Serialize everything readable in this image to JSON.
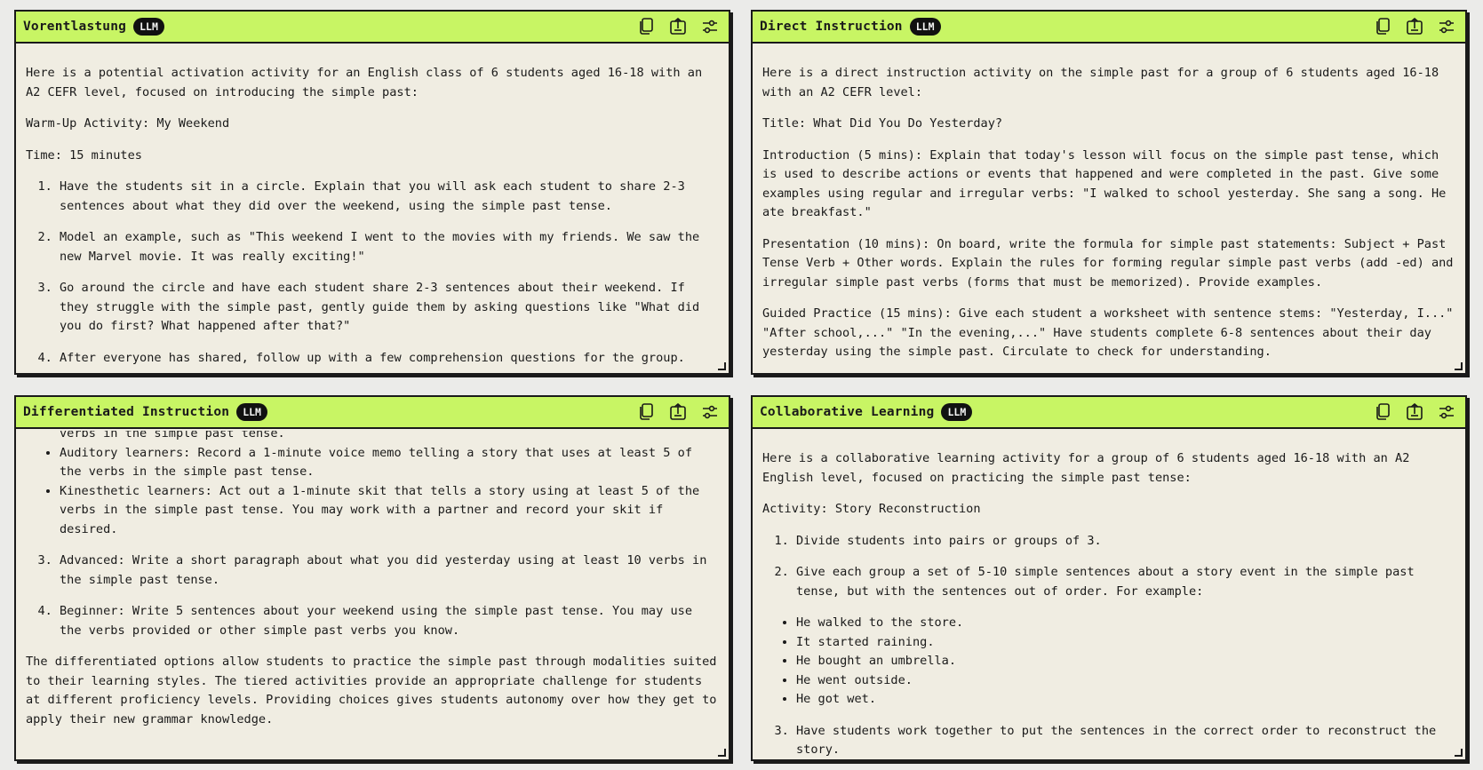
{
  "panels": [
    {
      "title": "Vorentlastung",
      "badge": "LLM",
      "intro": "Here is a potential activation activity for an English class of 6 students aged 16-18 with an A2 CEFR level, focused on introducing the simple past:",
      "activity": "Warm-Up Activity: My Weekend",
      "time": "Time: 15 minutes",
      "steps": [
        "Have the students sit in a circle. Explain that you will ask each student to share 2-3 sentences about what they did over the weekend, using the simple past tense.",
        "Model an example, such as \"This weekend I went to the movies with my friends. We saw the new Marvel movie. It was really exciting!\"",
        "Go around the circle and have each student share 2-3 sentences about their weekend. If they struggle with the simple past, gently guide them by asking questions like \"What did you do first? What happened after that?\"",
        "After everyone has shared, follow up with a few comprehension questions for the group."
      ]
    },
    {
      "title": "Direct Instruction",
      "badge": "LLM",
      "intro": "Here is a direct instruction activity on the simple past for a group of 6 students aged 16-18 with an A2 CEFR level:",
      "activity": "Title: What Did You Do Yesterday?",
      "paragraphs": [
        "Introduction (5 mins): Explain that today's lesson will focus on the simple past tense, which is used to describe actions or events that happened and were completed in the past. Give some examples using regular and irregular verbs: \"I walked to school yesterday. She sang a song. He ate breakfast.\"",
        "Presentation (10 mins): On board, write the formula for simple past statements: Subject + Past Tense Verb + Other words. Explain the rules for forming regular simple past verbs (add -ed) and irregular simple past verbs (forms that must be memorized). Provide examples.",
        "Guided Practice (15 mins): Give each student a worksheet with sentence stems: \"Yesterday, I...\" \"After school,...\" \"In the evening,...\" Have students complete 6-8 sentences about their day yesterday using the simple past. Circulate to check for understanding."
      ]
    },
    {
      "title": "Differentiated Instruction",
      "badge": "LLM",
      "bullet_partial": "verbs in the simple past tense.",
      "bullets": [
        "Auditory learners: Record a 1-minute voice memo telling a story that uses at least 5 of the verbs in the simple past tense.",
        "Kinesthetic learners: Act out a 1-minute skit that tells a story using at least 5 of the verbs in the simple past tense. You may work with a partner and record your skit if desired."
      ],
      "steps": [
        "Advanced: Write a short paragraph about what you did yesterday using at least 10 verbs in the simple past tense.",
        "Beginner: Write 5 sentences about your weekend using the simple past tense. You may use the verbs provided or other simple past verbs you know."
      ],
      "conclusion": "The differentiated options allow students to practice the simple past through modalities suited to their learning styles. The tiered activities provide an appropriate challenge for students at different proficiency levels. Providing choices gives students autonomy over how they get to apply their new grammar knowledge."
    },
    {
      "title": "Collaborative Learning",
      "badge": "LLM",
      "intro": "Here is a collaborative learning activity for a group of 6 students aged 16-18 with an A2 English level, focused on practicing the simple past tense:",
      "activity": "Activity: Story Reconstruction",
      "steps": [
        "Divide students into pairs or groups of 3.",
        "Give each group a set of 5-10 simple sentences about a story event in the simple past tense, but with the sentences out of order. For example:"
      ],
      "bullets": [
        "He walked to the store.",
        "It started raining.",
        "He bought an umbrella.",
        "He went outside.",
        "He got wet."
      ],
      "step3": "Have students work together to put the sentences in the correct order to reconstruct the story."
    }
  ],
  "icons": {
    "copy": "copy-icon",
    "export": "export-icon",
    "settings": "sliders-icon"
  },
  "colors": {
    "header": "#c8f564",
    "panel": "#f0ede2",
    "border": "#1a1a1a",
    "badge": "#111111"
  }
}
